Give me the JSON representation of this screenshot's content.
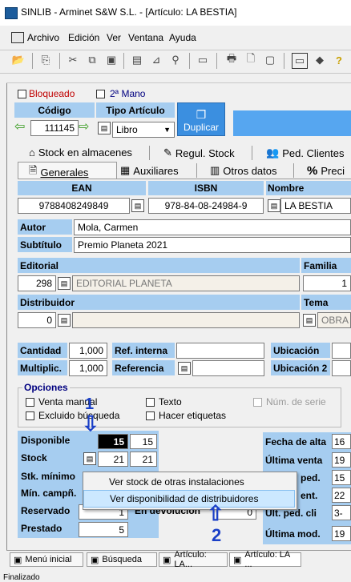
{
  "window": {
    "title": "SINLIB - Arminet S&W S.L. - [Artículo: LA BESTIA]"
  },
  "menu": [
    "Archivo",
    "Edición",
    "Ver",
    "Ventana",
    "Ayuda"
  ],
  "flags": {
    "bloqueado": "Bloqueado",
    "segunda_mano": "2ª Mano"
  },
  "codigo": {
    "label": "Código",
    "value": "111145"
  },
  "tipo": {
    "label": "Tipo Artículo",
    "value": "Libro"
  },
  "duplicar": "Duplicar",
  "tabs_row1": [
    "Stock en almacenes",
    "Regul. Stock",
    "Ped. Clientes"
  ],
  "tabs_row2": [
    "Generales",
    "Auxiliares",
    "Otros datos",
    "Preci"
  ],
  "ids": {
    "ean_label": "EAN",
    "isbn_label": "ISBN",
    "nombre_label": "Nombre",
    "ean": "9788408249849",
    "isbn": "978-84-08-24984-9",
    "nombre": "LA BESTIA"
  },
  "autor": {
    "label": "Autor",
    "value": "Mola, Carmen"
  },
  "subtitulo": {
    "label": "Subtítulo",
    "value": "Premio Planeta 2021"
  },
  "editorial": {
    "label": "Editorial",
    "code": "298",
    "name": "EDITORIAL PLANETA"
  },
  "familia": {
    "label": "Familia",
    "value": "1"
  },
  "distribuidor": {
    "label": "Distribuidor",
    "code": "0"
  },
  "tema": {
    "label": "Tema",
    "value": "OBRA"
  },
  "cantidad": {
    "label": "Cantidad",
    "value": "1,000"
  },
  "multiplic": {
    "label": "Multiplic.",
    "value": "1,000"
  },
  "ref_interna": {
    "label": "Ref. interna"
  },
  "referencia": {
    "label": "Referencia"
  },
  "ubicacion": {
    "label": "Ubicación"
  },
  "ubicacion2": {
    "label": "Ubicación 2"
  },
  "opciones": {
    "title": "Opciones",
    "venta_manual": "Venta manual",
    "texto": "Texto",
    "num_serie": "Núm. de serie",
    "excluido": "Excluido búsqueda",
    "etiquetas": "Hacer etiquetas"
  },
  "stock": {
    "disponible": {
      "label": "Disponible",
      "a": "15",
      "b": "15"
    },
    "stock": {
      "label": "Stock",
      "a": "21",
      "b": "21"
    },
    "stk_minimo": {
      "label": "Stk. mínimo"
    },
    "min_campana": {
      "label": "Mín. campñ."
    },
    "reservado": {
      "label": "Reservado",
      "a": "1"
    },
    "prestado": {
      "label": "Prestado",
      "a": "5"
    },
    "en_devolucion": {
      "label": "En devolución",
      "value": "0"
    }
  },
  "fechas": {
    "fecha_alta": "Fecha de alta",
    "ultima_venta": "Última venta",
    "ped": "ped.",
    "ent": "ent.",
    "ult_ped_cli": "Últ. ped. cli",
    "ultima_mod": "Última mod.",
    "v1": "16",
    "v2": "19",
    "v3": "15",
    "v4": "22",
    "v5": "3-",
    "v6": "19"
  },
  "context_menu": [
    "Ver stock de otras instalaciones",
    "Ver disponibilidad de distribuidores"
  ],
  "annotations": {
    "one": "1",
    "two": "2"
  },
  "taskbar": [
    "Menú inicial",
    "Búsqueda",
    "Artículo: LA...",
    "Artículo: LA ..."
  ],
  "status": "Finalizado"
}
